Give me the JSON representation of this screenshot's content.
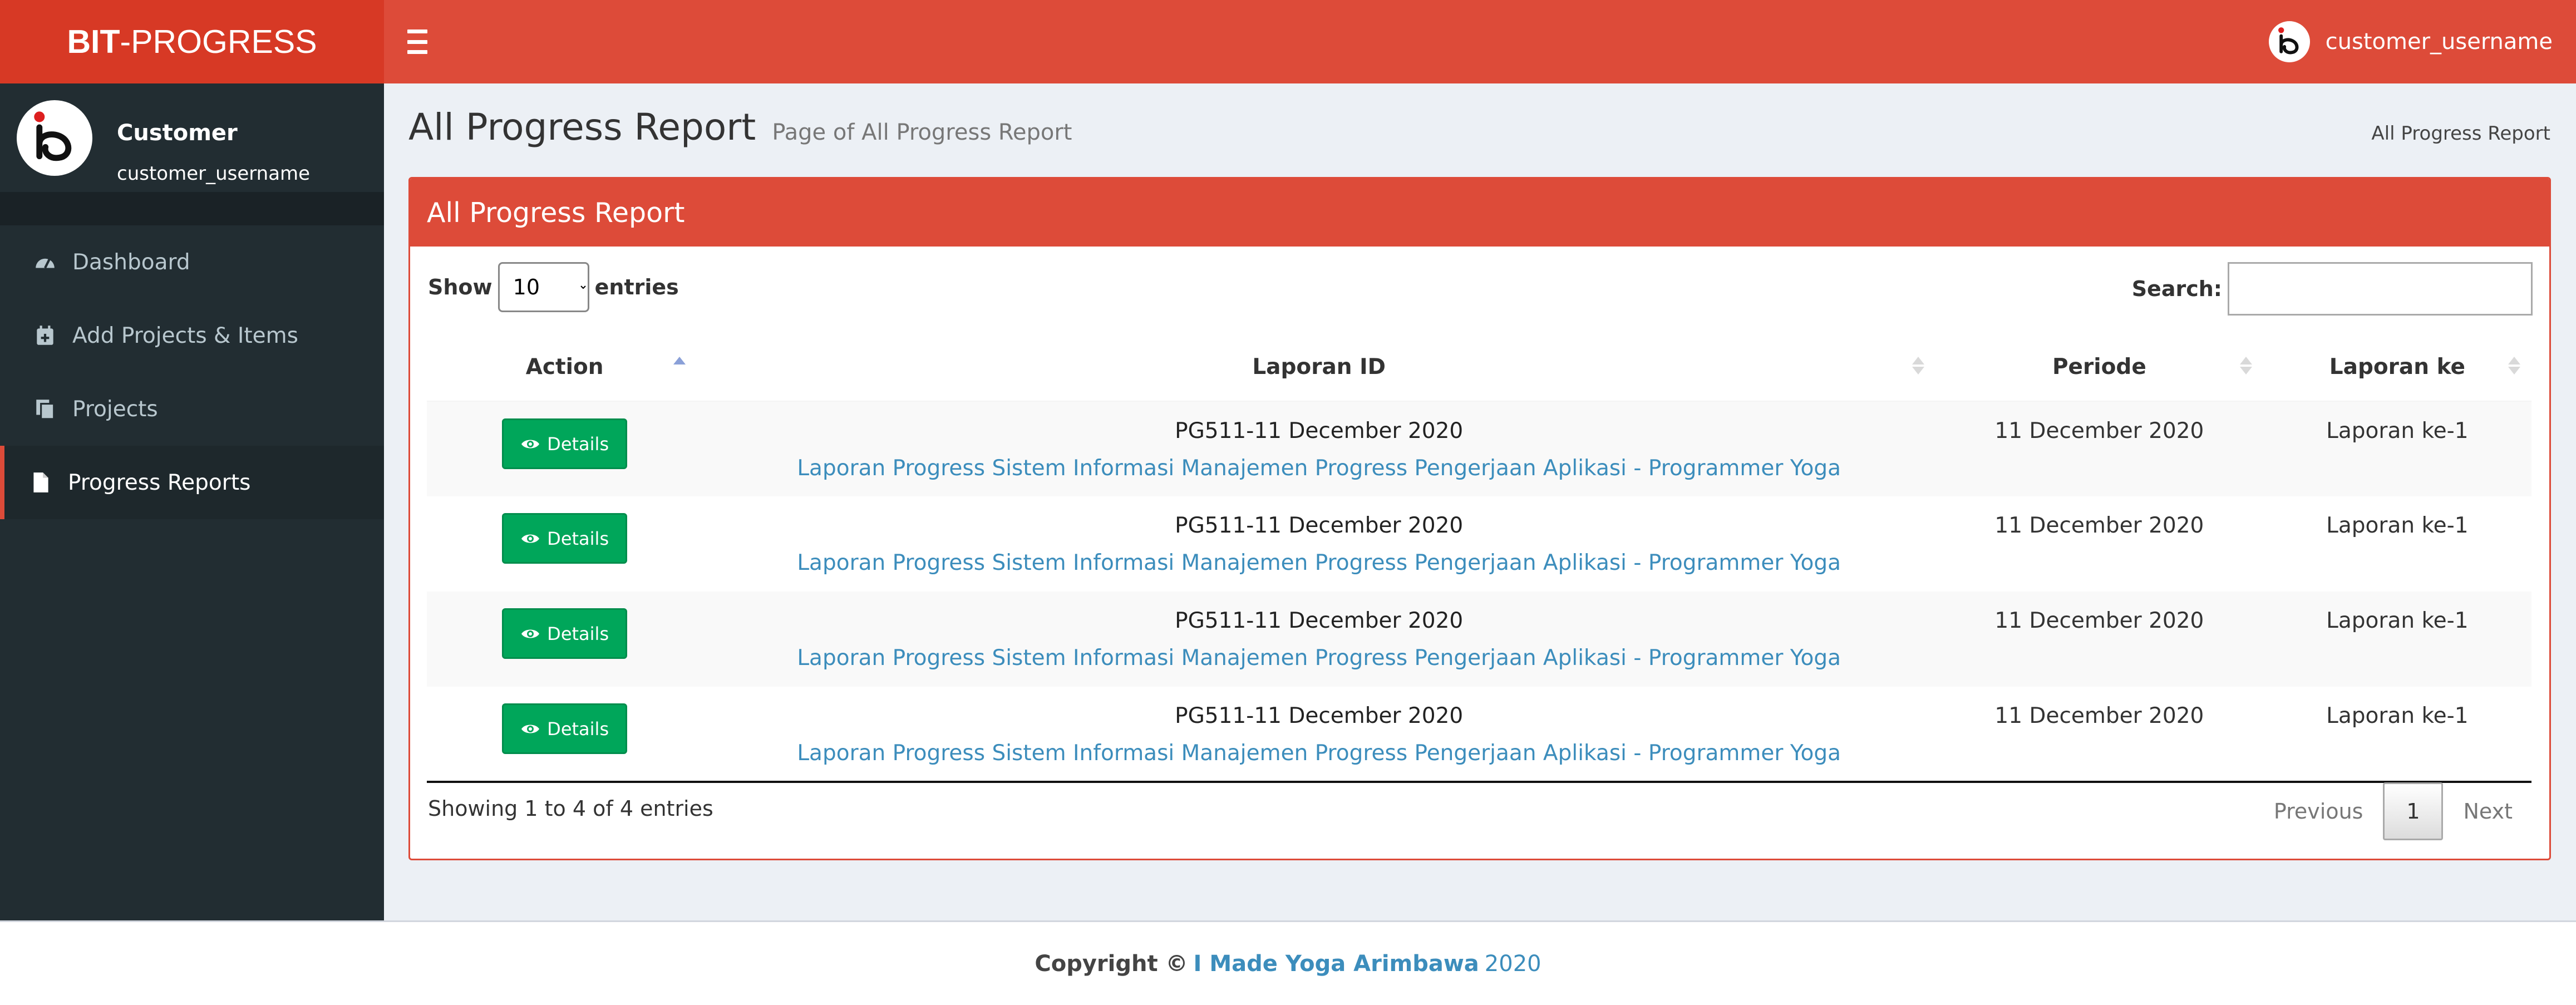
{
  "brand": {
    "bold": "BIT",
    "rest": "-PROGRESS"
  },
  "topbar": {
    "username": "customer_username"
  },
  "sidebar": {
    "user_name": "Customer",
    "user_sub": "customer_username",
    "items": [
      {
        "label": "Dashboard",
        "icon": "dashboard-icon"
      },
      {
        "label": "Add Projects & Items",
        "icon": "calendar-plus-icon"
      },
      {
        "label": "Projects",
        "icon": "copy-icon"
      },
      {
        "label": "Progress Reports",
        "icon": "file-icon"
      }
    ]
  },
  "header": {
    "title": "All Progress Report",
    "subtitle": "Page of All Progress Report",
    "breadcrumb": "All Progress Report"
  },
  "box": {
    "title": "All Progress Report",
    "show_label": "Show",
    "entries_value": "10",
    "entries_label": "entries",
    "search_label": "Search:",
    "search_value": ""
  },
  "table": {
    "columns": [
      "Action",
      "Laporan ID",
      "Periode",
      "Laporan ke"
    ],
    "rows": [
      {
        "button": "Details",
        "id": "PG511-11 December 2020",
        "link": "Laporan Progress Sistem Informasi Manajemen Progress Pengerjaan Aplikasi - Programmer Yoga",
        "periode": "11 December 2020",
        "ke": "Laporan ke-1"
      },
      {
        "button": "Details",
        "id": "PG511-11 December 2020",
        "link": "Laporan Progress Sistem Informasi Manajemen Progress Pengerjaan Aplikasi - Programmer Yoga",
        "periode": "11 December 2020",
        "ke": "Laporan ke-1"
      },
      {
        "button": "Details",
        "id": "PG511-11 December 2020",
        "link": "Laporan Progress Sistem Informasi Manajemen Progress Pengerjaan Aplikasi - Programmer Yoga",
        "periode": "11 December 2020",
        "ke": "Laporan ke-1"
      },
      {
        "button": "Details",
        "id": "PG511-11 December 2020",
        "link": "Laporan Progress Sistem Informasi Manajemen Progress Pengerjaan Aplikasi - Programmer Yoga",
        "periode": "11 December 2020",
        "ke": "Laporan ke-1"
      }
    ]
  },
  "pagination": {
    "info": "Showing 1 to 4 of 4 entries",
    "previous": "Previous",
    "current": "1",
    "next": "Next"
  },
  "footer": {
    "copyright": "Copyright ©",
    "author": "I Made Yoga Arimbawa",
    "year": "2020"
  },
  "colors": {
    "accent": "#dd4b39",
    "accent_dark": "#d73925",
    "sidebar": "#222d32",
    "success": "#00a65a",
    "link": "#3c8dbc"
  }
}
